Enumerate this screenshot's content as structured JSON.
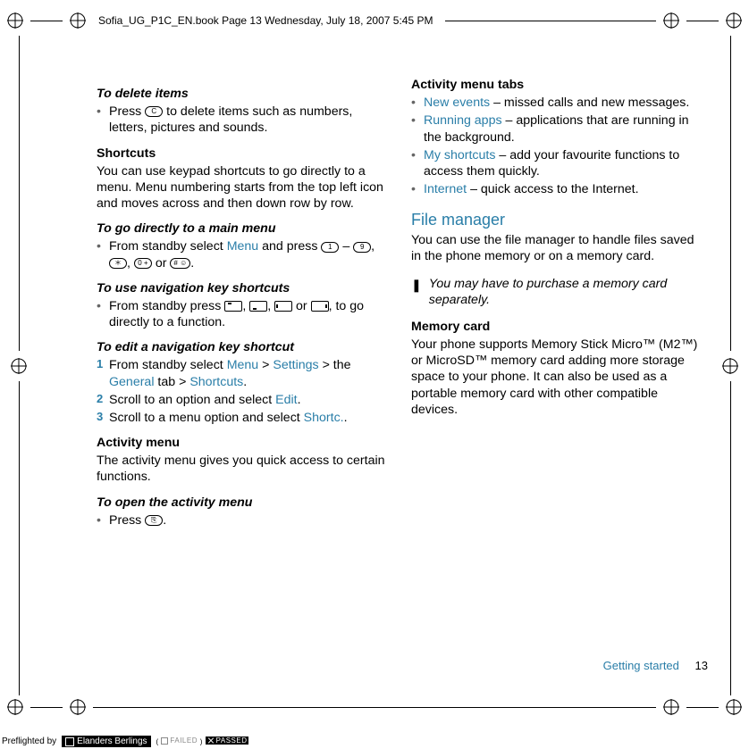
{
  "header_line": "Sofia_UG_P1C_EN.book  Page 13  Wednesday, July 18, 2007  5:45 PM",
  "col1": {
    "h1": "To delete items",
    "b1": "Press ",
    "b1k": "C",
    "b1after": " to delete items such as numbers, letters, pictures and sounds.",
    "h2": "Shortcuts",
    "p2": "You can use keypad shortcuts to go directly to a menu. Menu numbering starts from the top left icon and moves across and then down row by row.",
    "h3": "To go directly to a main menu",
    "b3a": "From standby select ",
    "b3menu": "Menu",
    "b3b": " and press ",
    "k1": "1",
    "dash": " – ",
    "k9": "9",
    "comma": ", ",
    "kstar": "＊",
    "k0": "0 +",
    "or": " or ",
    "khash": "# ☺",
    "period": ".",
    "h4": "To use navigation key shortcuts",
    "b4a": "From standby press ",
    "b4b": " to go directly to a function.",
    "h5": "To edit a navigation key shortcut",
    "s1a": "From standby select ",
    "s1menu": "Menu",
    "s1gt1": " > ",
    "s1settings": "Settings",
    "s1gt2": " > the ",
    "s1general": "General",
    "s1tab": " tab > ",
    "s1shortcuts": "Shortcuts",
    "s2a": "Scroll to an option and select ",
    "s2edit": "Edit",
    "s3a": "Scroll to a menu option and select ",
    "s3shortc": "Shortc.",
    "h6": "Activity menu",
    "p6": "The activity menu gives you quick access to certain functions.",
    "h7": "To open the activity menu",
    "b7a": "Press ",
    "b7k": "⎘"
  },
  "col2": {
    "h1": "Activity menu tabs",
    "i1": "New events",
    "t1": " – missed calls and new messages.",
    "i2": "Running apps",
    "t2": " – applications that are running in the background.",
    "i3": "My shortcuts",
    "t3": " – add your favourite functions to access them quickly.",
    "i4": "Internet",
    "t4": " – quick access to the Internet.",
    "sec": "File manager",
    "p1": "You can use the file manager to handle files saved in the phone memory or on a memory card.",
    "note": "You may have to purchase a memory card separately.",
    "h2": "Memory card",
    "p2": "Your phone supports Memory Stick Micro™ (M2™) or MicroSD™ memory card adding more storage space to your phone. It can also be used as a portable memory card with other compatible devices."
  },
  "footer": {
    "section": "Getting started",
    "page": "13"
  },
  "preflight": {
    "label": "Preflighted by",
    "brand": "Elanders Berlings",
    "failed": "FAILED",
    "passed": "PASSED"
  }
}
